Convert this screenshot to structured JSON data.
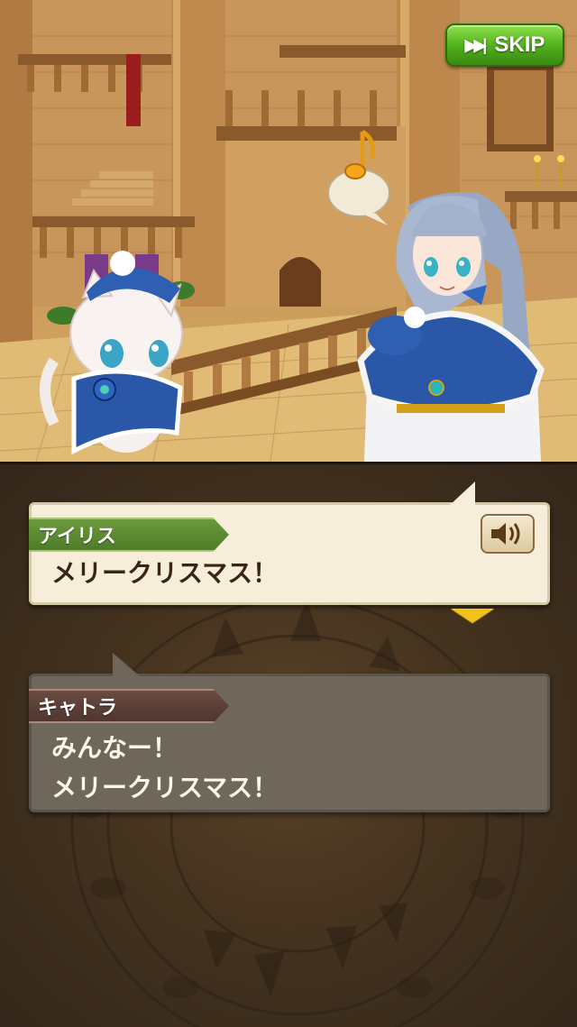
{
  "header": {
    "skip_label": "SKIP",
    "skip_icon": "fast-forward-icon"
  },
  "scene": {
    "emote_icon": "music-note-icon"
  },
  "dialogue": {
    "current": {
      "speaker": "アイリス",
      "text": "メリークリスマス！",
      "voice_icon": "speaker-icon"
    },
    "previous": {
      "speaker": "キャトラ",
      "text": "みんなー！\nメリークリスマス！"
    },
    "advance_icon": "triangle-down-icon"
  },
  "colors": {
    "skip_button": "#4fae1c",
    "active_bubble": "#f6eedb",
    "inactive_bubble": "#6f675b",
    "nametag_active": "#5a8a30",
    "nametag_inactive": "#5a3e35",
    "advance_arrow": "#f2c21c"
  }
}
